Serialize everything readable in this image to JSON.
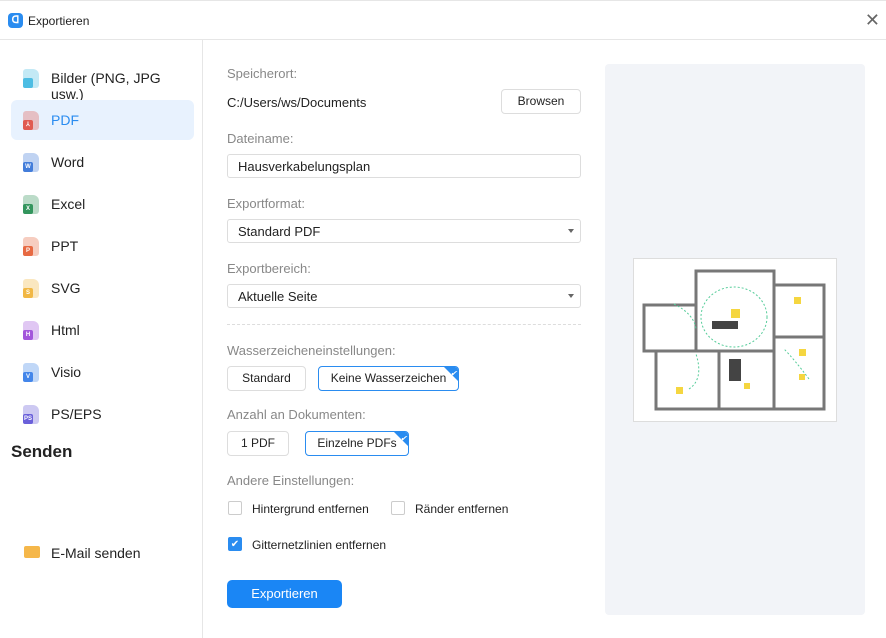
{
  "window": {
    "title": "Exportieren",
    "app_icon": "edraw-logo-icon",
    "close_icon": "close-icon"
  },
  "sidebar": {
    "items": [
      {
        "label": "Bilder (PNG, JPG usw.)",
        "icon": "image-file-icon",
        "badge": "",
        "color": "#3ab6e0"
      },
      {
        "label": "PDF",
        "icon": "pdf-file-icon",
        "badge": "⅄",
        "color": "#e04a3f",
        "active": true
      },
      {
        "label": "Word",
        "icon": "word-file-icon",
        "badge": "W",
        "color": "#2f6fd6"
      },
      {
        "label": "Excel",
        "icon": "excel-file-icon",
        "badge": "X",
        "color": "#1e8a4c"
      },
      {
        "label": "PPT",
        "icon": "ppt-file-icon",
        "badge": "P",
        "color": "#e55a2f"
      },
      {
        "label": "SVG",
        "icon": "svg-file-icon",
        "badge": "S",
        "color": "#f0b030"
      },
      {
        "label": "Html",
        "icon": "html-file-icon",
        "badge": "H",
        "color": "#9a44d8"
      },
      {
        "label": "Visio",
        "icon": "visio-file-icon",
        "badge": "V",
        "color": "#2f7ae8"
      },
      {
        "label": "PS/EPS",
        "icon": "ps-file-icon",
        "badge": "PS",
        "color": "#5a4fd6"
      }
    ],
    "send_heading": "Senden",
    "send_items": [
      {
        "label": "E-Mail senden",
        "icon": "mail-icon"
      }
    ]
  },
  "form": {
    "location_label": "Speicherort:",
    "location_value": "C:/Users/ws/Documents",
    "browse": "Browsen",
    "filename_label": "Dateiname:",
    "filename_value": "Hausverkabelungsplan",
    "format_label": "Exportformat:",
    "format_value": "Standard PDF",
    "range_label": "Exportbereich:",
    "range_value": "Aktuelle Seite",
    "watermark_label": "Wasserzeicheneinstellungen:",
    "watermark_options": [
      "Standard",
      "Keine Wasserzeichen"
    ],
    "watermark_selected": "Keine Wasserzeichen",
    "docs_label": "Anzahl an Dokumenten:",
    "docs_options": [
      "1 PDF",
      "Einzelne PDFs"
    ],
    "docs_selected": "Einzelne PDFs",
    "other_label": "Andere Einstellungen:",
    "checkboxes": [
      {
        "label": "Hintergrund entfernen",
        "checked": false
      },
      {
        "label": "Ränder entfernen",
        "checked": false
      },
      {
        "label": "Gitternetzlinien entfernen",
        "checked": true
      }
    ],
    "export": "Exportieren"
  },
  "colors": {
    "accent": "#1a86f5",
    "active_bg": "#e8f2fe"
  }
}
